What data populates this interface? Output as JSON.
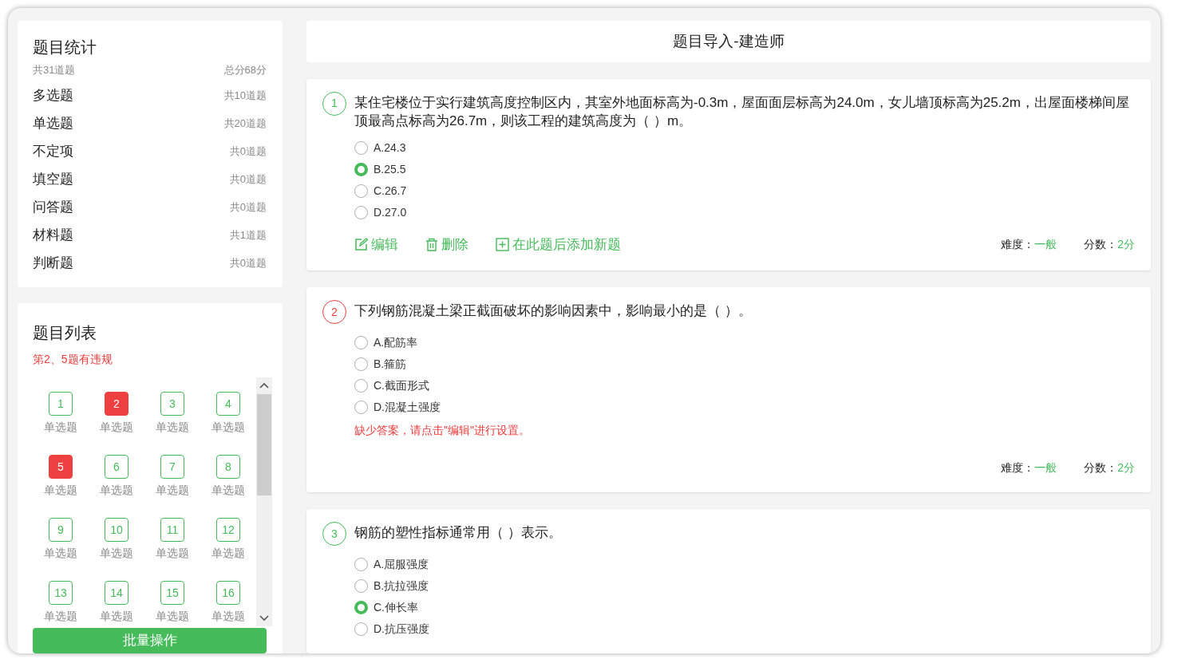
{
  "stats": {
    "title": "题目统计",
    "total_count": "共31道题",
    "total_score": "总分68分",
    "items": [
      {
        "name": "多选题",
        "count": "共10道题"
      },
      {
        "name": "单选题",
        "count": "共20道题"
      },
      {
        "name": "不定项",
        "count": "共0道题"
      },
      {
        "name": "填空题",
        "count": "共0道题"
      },
      {
        "name": "问答题",
        "count": "共0道题"
      },
      {
        "name": "材料题",
        "count": "共1道题"
      },
      {
        "name": "判断题",
        "count": "共0道题"
      }
    ]
  },
  "question_list": {
    "title": "题目列表",
    "warning": "第2、5题有违规",
    "items": [
      {
        "number": "1",
        "type": "单选题",
        "violation": false
      },
      {
        "number": "2",
        "type": "单选题",
        "violation": true
      },
      {
        "number": "3",
        "type": "单选题",
        "violation": false
      },
      {
        "number": "4",
        "type": "单选题",
        "violation": false
      },
      {
        "number": "5",
        "type": "单选题",
        "violation": true
      },
      {
        "number": "6",
        "type": "单选题",
        "violation": false
      },
      {
        "number": "7",
        "type": "单选题",
        "violation": false
      },
      {
        "number": "8",
        "type": "单选题",
        "violation": false
      },
      {
        "number": "9",
        "type": "单选题",
        "violation": false
      },
      {
        "number": "10",
        "type": "单选题",
        "violation": false
      },
      {
        "number": "11",
        "type": "单选题",
        "violation": false
      },
      {
        "number": "12",
        "type": "单选题",
        "violation": false
      },
      {
        "number": "13",
        "type": "单选题",
        "violation": false
      },
      {
        "number": "14",
        "type": "单选题",
        "violation": false
      },
      {
        "number": "15",
        "type": "单选题",
        "violation": false
      },
      {
        "number": "16",
        "type": "单选题",
        "violation": false
      }
    ],
    "batch_button": "批量操作"
  },
  "header": {
    "title": "题目导入-建造师"
  },
  "questions": [
    {
      "number": "1",
      "violation": false,
      "text": "某住宅楼位于实行建筑高度控制区内，其室外地面标高为-0.3m，屋面面层标高为24.0m，女儿墙顶标高为25.2m，出屋面楼梯间屋顶最高点标高为26.7m，则该工程的建筑高度为（ ）m。",
      "options": [
        {
          "label": "A.24.3",
          "selected": false
        },
        {
          "label": "B.25.5",
          "selected": true
        },
        {
          "label": "C.26.7",
          "selected": false
        },
        {
          "label": "D.27.0",
          "selected": false
        }
      ],
      "actions": [
        {
          "kind": "edit",
          "label": "编辑"
        },
        {
          "kind": "delete",
          "label": "删除"
        },
        {
          "kind": "add",
          "label": "在此题后添加新题"
        }
      ],
      "difficulty_label": "难度：",
      "difficulty": "一般",
      "score_label": "分数：",
      "score": "2分"
    },
    {
      "number": "2",
      "violation": true,
      "text": "下列钢筋混凝土梁正截面破坏的影响因素中，影响最小的是（ ）。",
      "options": [
        {
          "label": "A.配筋率",
          "selected": false
        },
        {
          "label": "B.箍筋",
          "selected": false
        },
        {
          "label": "C.截面形式",
          "selected": false
        },
        {
          "label": "D.混凝土强度",
          "selected": false
        }
      ],
      "warning": "缺少答案，请点击\"编辑\"进行设置。",
      "difficulty_label": "难度：",
      "difficulty": "一般",
      "score_label": "分数：",
      "score": "2分"
    },
    {
      "number": "3",
      "violation": false,
      "text": "钢筋的塑性指标通常用（ ）表示。",
      "options": [
        {
          "label": "A.屈服强度",
          "selected": false
        },
        {
          "label": "B.抗拉强度",
          "selected": false
        },
        {
          "label": "C.伸长率",
          "selected": true
        },
        {
          "label": "D.抗压强度",
          "selected": false
        }
      ]
    }
  ]
}
